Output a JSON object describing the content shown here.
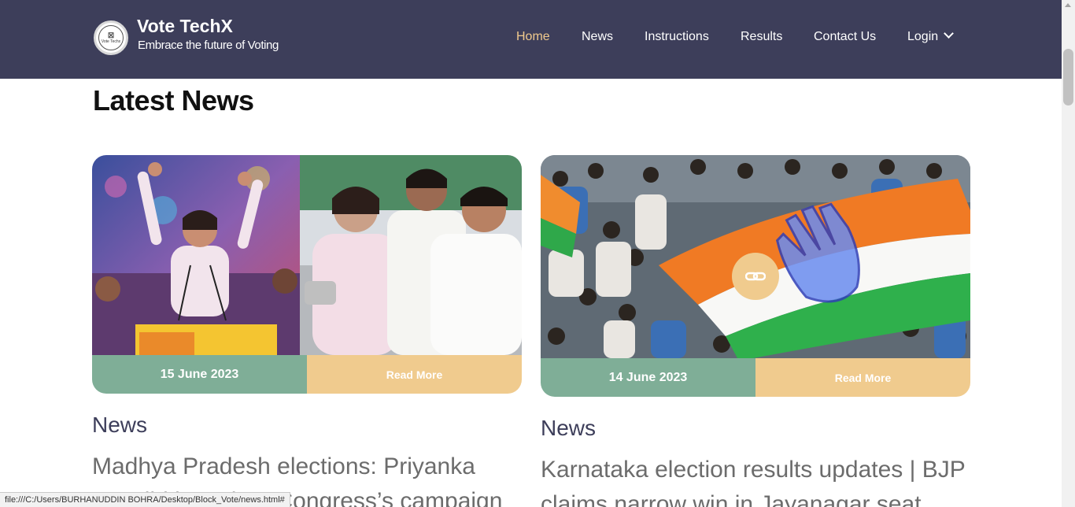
{
  "header": {
    "brand_title": "Vote TechX",
    "brand_tagline": "Embrace the future of Voting",
    "logo_mark": "☒",
    "logo_text": "Vote Techx",
    "nav": [
      {
        "label": "Home",
        "active": true
      },
      {
        "label": "News",
        "active": false
      },
      {
        "label": "Instructions",
        "active": false
      },
      {
        "label": "Results",
        "active": false
      },
      {
        "label": "Contact Us",
        "active": false
      },
      {
        "label": "Login",
        "active": false,
        "dropdown": true
      }
    ]
  },
  "main": {
    "section_title": "Latest News",
    "cards": [
      {
        "date": "15 June 2023",
        "read_more": "Read More",
        "category": "News",
        "headline_line1": "Madhya Pradesh elections: Priyanka",
        "headline_line2": "Gandhi launches Congress’s campaign",
        "image_desc": "rally-photo"
      },
      {
        "date": "14 June 2023",
        "read_more": "Read More",
        "category": "News",
        "headline_line1": "Karnataka election results updates | BJP",
        "headline_line2": "claims narrow win in Jayanagar seat",
        "image_desc": "flag-crowd-photo"
      }
    ]
  },
  "status_bar": {
    "url": "file:///C:/Users/BURHANUDDIN BOHRA/Desktop/Block_Vote/news.html#"
  },
  "colors": {
    "header_bg": "#3d3e5a",
    "nav_active": "#f0c98d",
    "date_bg": "#7fae97",
    "read_bg": "#f0cb8e",
    "category_text": "#3d3e5a",
    "headline_text": "#6c6c6c"
  },
  "icons": [
    "chevron-down-icon",
    "link-icon"
  ]
}
